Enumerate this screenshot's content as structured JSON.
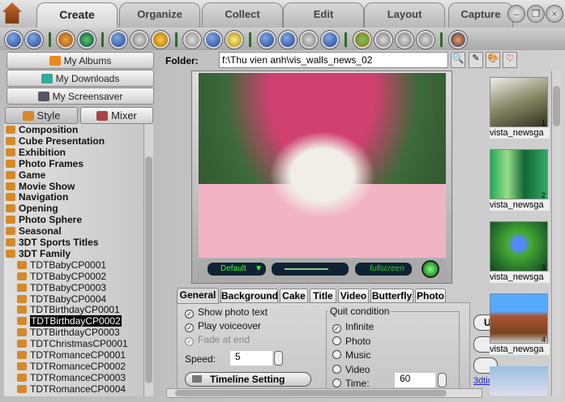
{
  "tabs": [
    "Create",
    "Organize",
    "Collect",
    "Edit",
    "Layout",
    "Capture"
  ],
  "window_buttons": [
    "minimize",
    "restore",
    "close"
  ],
  "left": {
    "buttons": [
      "My Albums",
      "My Downloads",
      "My Screensaver"
    ],
    "subtabs": [
      "Style",
      "Mixer"
    ],
    "tree": [
      "Composition",
      "Cube Presentation",
      "Exhibition",
      "Photo Frames",
      "Game",
      "Movie Show",
      "Navigation",
      "Opening",
      "Photo Sphere",
      "Seasonal",
      "3DT Sports Titles",
      "3DT Family"
    ],
    "children": [
      "TDTBabyCP0001",
      "TDTBabyCP0002",
      "TDTBabyCP0003",
      "TDTBabyCP0004",
      "TDTBirthdayCP0001",
      "TDTBirthdayCP0002",
      "TDTBirthdayCP0003",
      "TDTChristmasCP0001",
      "TDTRomanceCP0001",
      "TDTRomanceCP0002",
      "TDTRomanceCP0003",
      "TDTRomanceCP0004"
    ],
    "selected": "TDTBirthdayCP0002"
  },
  "folder": {
    "label": "Folder:",
    "path": "f:\\Thu vien anh\\vis_walls_news_02"
  },
  "player": {
    "mode": "Default",
    "fullscreen": "fullscreen",
    "volume": 0.75
  },
  "settings": {
    "tabs": [
      "General",
      "Background",
      "Cake",
      "Title",
      "Video",
      "Butterfly",
      "Photo"
    ],
    "checks": [
      {
        "label": "Show photo text",
        "checked": true
      },
      {
        "label": "Play voiceover",
        "checked": true
      },
      {
        "label": "Fade at end",
        "checked": true,
        "disabled": true
      }
    ],
    "speed_label": "Speed:",
    "speed": "5",
    "timeline": "Timeline Setting",
    "quit_title": "Quit condition",
    "quit_options": [
      "Infinite",
      "Photo",
      "Music",
      "Video",
      "Time:"
    ],
    "quit_selected": "Infinite",
    "time": "60"
  },
  "thumbs": [
    {
      "label": "vista_newsga",
      "num": "1"
    },
    {
      "label": "vista_newsga",
      "num": "2"
    },
    {
      "label": "vista_newsga",
      "num": "3"
    },
    {
      "label": "vista_newsga",
      "num": "4"
    }
  ],
  "side": {
    "u_button": "U",
    "link": "3dtin"
  }
}
